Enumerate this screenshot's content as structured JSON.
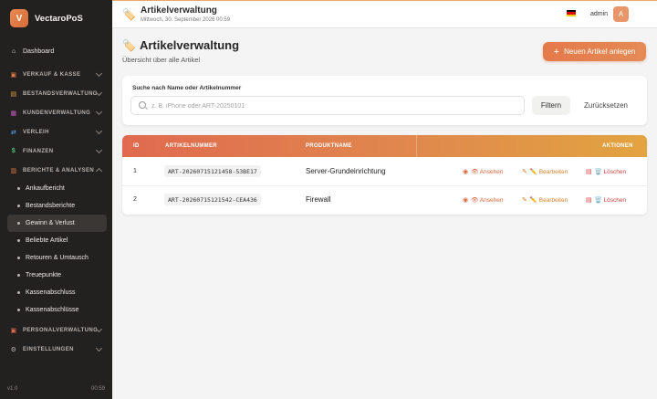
{
  "app": {
    "logo_letter": "V",
    "name": "VectaroPoS",
    "version": "v1.0",
    "clock": "00:59"
  },
  "sidebar": {
    "dashboard": "Dashboard",
    "sections": [
      {
        "label": "VERKAUF & KASSE"
      },
      {
        "label": "BESTANDSVERWALTUNG"
      },
      {
        "label": "KUNDENVERWALTUNG"
      },
      {
        "label": "VERLEIH"
      },
      {
        "label": "FINANZEN"
      },
      {
        "label": "BERICHTE & ANALYSEN"
      }
    ],
    "sub_items": [
      "Ankaufbericht",
      "Bestandsberichte",
      "Gewinn & Verlust",
      "Beliebte Artikel",
      "Retouren & Umtausch",
      "Treuepunkte",
      "Kassenabschluss",
      "Kassenabschlüsse"
    ],
    "active_sub": "Gewinn & Verlust",
    "bottom_sections": [
      {
        "label": "PERSONALVERWALTUNG"
      },
      {
        "label": "EINSTELLUNGEN"
      }
    ]
  },
  "topbar": {
    "title": "Artikelverwaltung",
    "date": "Mittwoch, 30. September 2026 00:59",
    "user": "admin",
    "avatar_letter": "A",
    "language_flag": "de-flag-icon"
  },
  "page": {
    "title": "Artikelverwaltung",
    "subtitle": "Übersicht über alle Artikel",
    "new_button": "Neuen Artikel anlegen"
  },
  "search": {
    "label": "Suche nach Name oder Artikelnummer",
    "placeholder": "z. B. iPhone oder ART-20250101",
    "value": "",
    "filter_button": "Filtern",
    "reset_button": "Zurücksetzen"
  },
  "table": {
    "headers": {
      "id": "ID",
      "number": "ARTIKELNUMMER",
      "name": "PRODUKTNAME",
      "actions": "AKTIONEN"
    },
    "rows": [
      {
        "id": "1",
        "number": "ART-20260715121458-53BE17",
        "name": "Server-Grundeinrichtung"
      },
      {
        "id": "2",
        "number": "ART-20260715121542-CEA436",
        "name": "Firewall"
      }
    ],
    "action_labels": {
      "view": "👁 Ansehen",
      "edit": "✏️ Bearbeiten",
      "delete": "🗑️ Löschen"
    }
  },
  "colors": {
    "accent": "#e5794a",
    "sidebar_bg": "#232120",
    "header_gradient_start": "#e06a4f",
    "header_gradient_end": "#e2a43f"
  }
}
